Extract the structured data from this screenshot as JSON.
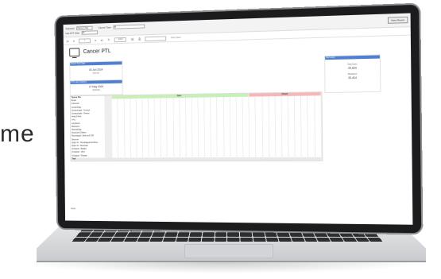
{
  "background_text": "me",
  "filters": {
    "standard_label": "Standard",
    "standard_value": "Cancer 2 Day",
    "cancer_type_label": "Cancer Type",
    "cancer_type_value": "All",
    "org_label": "Has DTT Date",
    "org_value": "All",
    "view_report": "View Report"
  },
  "toolbar": {
    "page_value": "1",
    "zoom_value": "100%",
    "find_label": "Find | Next"
  },
  "report": {
    "title": "Cancer PTL",
    "panels": {
      "left_top_head": "Report Run Date",
      "left_top_value": "03 Jun 2024",
      "left_top_sub": "9:00 am",
      "left_bottom_head": "PTL Last Updated",
      "left_bottom_value": "27 May 2024",
      "left_bottom_sub": "00:00:00",
      "right_head": "Summary",
      "right_value1_label": "Total Open",
      "right_value1": "20,624",
      "right_value2_label": "Breached",
      "right_value2": "20,414"
    },
    "groups": {
      "green": "Open",
      "pink": "Closed"
    },
    "col_header_label": "Tumour Site",
    "total_label": "Total",
    "rows": [
      "Breast",
      "Colorectal",
      "Gynaecology",
      "Gynaecologist - Cervical",
      "Gynaecologist - Ovarian",
      "Head & Neck",
      "Lung",
      "Lymphoma",
      "Melanoma",
      "Haematology",
      "Suspected Children",
      "Neurological - Brain and CNS",
      "Sarcoma",
      "Upper GI - Oesophageal and Stom",
      "Upper GI - Pancreatic",
      "Urological - Bladder",
      "Urological - Other",
      "Urological - Prostate"
    ],
    "footnote": "Notes"
  },
  "colors": {
    "header_blue": "#4e7fd1",
    "green_band": "#c7f0b8",
    "pink_band": "#f6b7b7"
  }
}
